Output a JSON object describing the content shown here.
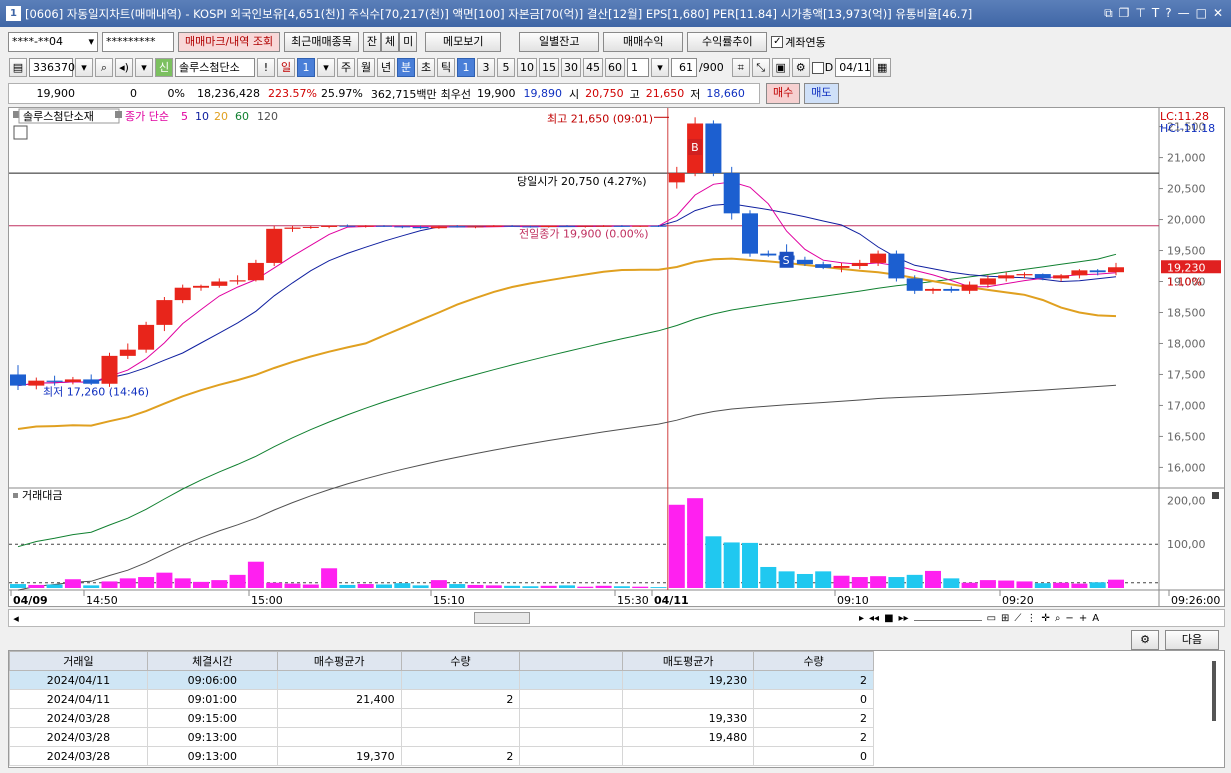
{
  "window": {
    "num": "1",
    "title": "[0606] 자동일지차트(매매내역) - KOSPI 외국인보유[4,651(천)] 주식수[70,217(천)] 액면[100] 자본금[70(억)] 결산[12월] EPS[1,680] PER[11.84] 시가총액[13,973(억)] 유통비율[46.7]"
  },
  "account": {
    "number": "****-**04",
    "password": "*********",
    "btn_mark": "매매마크/내역 조회",
    "btn_recent": "최근매매종목",
    "b_jan": "잔",
    "b_che": "체",
    "b_mi": "미",
    "btn_memo": "메모보기",
    "btn_daily": "일별잔고",
    "btn_profit": "매매수익",
    "btn_trend": "수익률추이",
    "chk_link": "계좌연동"
  },
  "toolbar": {
    "code": "336370",
    "credit": "신",
    "stock_name": "솔루스첨단소",
    "period": {
      "il": "일",
      "n": "1",
      "ju": "주",
      "wol": "월",
      "nyeon": "년",
      "bun": "분",
      "cho": "초",
      "tik": "틱"
    },
    "intervals": [
      "1",
      "3",
      "5",
      "10",
      "15",
      "30",
      "45",
      "60"
    ],
    "count_sel": "1",
    "count": "61",
    "count_max": "/900",
    "d_label": "D",
    "date": "04/11"
  },
  "quote": {
    "price": "19,900",
    "change": "0",
    "rate": "0%",
    "volume": "18,236,428",
    "v1": "223.57%",
    "v2": "25.97%",
    "amount": "362,715백만",
    "bid_label": "최우선",
    "bid1": "19,900",
    "bid2": "19,890",
    "open_label": "시",
    "open": "20,750",
    "high_label": "고",
    "high": "21,650",
    "low_label": "저",
    "low": "18,660",
    "buy": "매수",
    "sell": "매도"
  },
  "chart": {
    "stock": "솔루스첨단소재",
    "ma_label": "종가 단순",
    "ma_periods": [
      "5",
      "10",
      "20",
      "60",
      "120"
    ],
    "ma_colors": {
      "5": "#e000a0",
      "10": "#1020a0",
      "20": "#e0a020",
      "60": "#108030",
      "120": "#505050"
    },
    "lc": "LC:11.28",
    "hc": "HC:-11.18",
    "current": "19,230",
    "current_pct": "1.10%",
    "y_ticks": [
      "21,500",
      "21,000",
      "20,500",
      "20,000",
      "19,500",
      "19,000",
      "18,500",
      "18,000",
      "17,500",
      "17,000",
      "16,500",
      "16,000"
    ],
    "ann_high": "최고 21,650 (09:01)",
    "ann_open": "당일시가 20,750 (4.27%)",
    "ann_prev": "전일종가 19,900 (0.00%)",
    "ann_low": "최저 17,260 (14:46)",
    "mark_buy": "B",
    "mark_sell": "S",
    "vol_title": "거래대금",
    "vol_ticks": [
      "200,00",
      "100,00"
    ],
    "x_labels": [
      "04/09",
      "14:50",
      "15:00",
      "15:10",
      "15:30",
      "04/11",
      "09:10",
      "09:20",
      "09:26:00"
    ],
    "up": "#e8251b",
    "down": "#1c5fd0",
    "vol_up": "#ff20f0",
    "vol_down": "#20c8f0"
  },
  "chart_data": {
    "type": "candlestick",
    "candles": [
      [
        17500,
        17650,
        17250,
        17320
      ],
      [
        17320,
        17450,
        17260,
        17400
      ],
      [
        17400,
        17480,
        17320,
        17380
      ],
      [
        17380,
        17460,
        17340,
        17420
      ],
      [
        17420,
        17500,
        17330,
        17350
      ],
      [
        17350,
        17850,
        17300,
        17800
      ],
      [
        17800,
        18000,
        17750,
        17900
      ],
      [
        17900,
        18350,
        17850,
        18300
      ],
      [
        18300,
        18750,
        18200,
        18700
      ],
      [
        18700,
        18950,
        18650,
        18900
      ],
      [
        18900,
        18950,
        18850,
        18930
      ],
      [
        18930,
        19050,
        18900,
        19000
      ],
      [
        19000,
        19100,
        18950,
        19020
      ],
      [
        19020,
        19350,
        19000,
        19300
      ],
      [
        19300,
        19900,
        19250,
        19850
      ],
      [
        19850,
        19900,
        19800,
        19870
      ],
      [
        19870,
        19900,
        19850,
        19880
      ],
      [
        19880,
        19900,
        19860,
        19900
      ],
      [
        19900,
        19920,
        19880,
        19890
      ],
      [
        19890,
        19910,
        19870,
        19900
      ],
      [
        19900,
        19910,
        19880,
        19890
      ],
      [
        19890,
        19900,
        19860,
        19880
      ],
      [
        19880,
        19900,
        19850,
        19860
      ],
      [
        19860,
        19900,
        19850,
        19890
      ],
      [
        19890,
        19910,
        19870,
        19880
      ],
      [
        19880,
        19900,
        19860,
        19890
      ],
      [
        19890,
        19910,
        19880,
        19900
      ],
      [
        19900,
        19910,
        19880,
        19890
      ],
      [
        19890,
        19900,
        19870,
        19880
      ],
      [
        19880,
        19900,
        19870,
        19900
      ],
      [
        19900,
        19910,
        19880,
        19890
      ],
      [
        19890,
        19900,
        19870,
        19900
      ],
      [
        19900,
        19910,
        19880,
        19900
      ],
      [
        19900,
        19910,
        19880,
        19890
      ],
      [
        19890,
        19900,
        19880,
        19900
      ],
      [
        19900,
        19910,
        19880,
        19890
      ],
      [
        20600,
        20850,
        20500,
        20750
      ],
      [
        20750,
        21650,
        20700,
        21550
      ],
      [
        21550,
        21600,
        20700,
        20750
      ],
      [
        20750,
        20850,
        20000,
        20100
      ],
      [
        20100,
        20150,
        19400,
        19450
      ],
      [
        19450,
        19500,
        19400,
        19420
      ],
      [
        19420,
        19600,
        19300,
        19350
      ],
      [
        19350,
        19400,
        19250,
        19280
      ],
      [
        19280,
        19320,
        19200,
        19220
      ],
      [
        19220,
        19300,
        19150,
        19250
      ],
      [
        19250,
        19350,
        19200,
        19300
      ],
      [
        19300,
        19500,
        19250,
        19450
      ],
      [
        19450,
        19500,
        19000,
        19050
      ],
      [
        19050,
        19100,
        18800,
        18850
      ],
      [
        18850,
        18900,
        18800,
        18880
      ],
      [
        18880,
        18920,
        18820,
        18850
      ],
      [
        18850,
        19000,
        18800,
        18950
      ],
      [
        18950,
        19100,
        18900,
        19050
      ],
      [
        19050,
        19150,
        19000,
        19100
      ],
      [
        19100,
        19150,
        19050,
        19120
      ],
      [
        19120,
        19130,
        19020,
        19050
      ],
      [
        19050,
        19120,
        19000,
        19100
      ],
      [
        19100,
        19200,
        19050,
        19180
      ],
      [
        19180,
        19200,
        19100,
        19150
      ],
      [
        19150,
        19300,
        19100,
        19230
      ]
    ],
    "volumes": [
      9,
      7,
      8,
      20,
      6,
      15,
      22,
      25,
      35,
      22,
      14,
      18,
      30,
      60,
      12,
      10,
      8,
      45,
      7,
      9,
      8,
      11,
      6,
      18,
      9,
      7,
      6,
      5,
      4,
      5,
      6,
      3,
      5,
      4,
      3,
      2,
      190,
      205,
      118,
      104,
      103,
      48,
      38,
      32,
      38,
      28,
      25,
      27,
      25,
      30,
      39,
      22,
      12,
      18,
      17,
      15,
      11,
      12,
      10,
      13,
      19
    ],
    "ylim": [
      15700,
      21800
    ],
    "vol_max": 210
  },
  "table": {
    "headers": [
      "거래일",
      "체결시간",
      "매수평균가",
      "수량",
      "",
      "매도평균가",
      "수량"
    ],
    "rows": [
      [
        "2024/04/11",
        "09:06:00",
        "",
        "",
        "",
        "19,230",
        "2"
      ],
      [
        "2024/04/11",
        "09:01:00",
        "21,400",
        "2",
        "",
        "",
        "0"
      ],
      [
        "2024/03/28",
        "09:15:00",
        "",
        "",
        "",
        "19,330",
        "2"
      ],
      [
        "2024/03/28",
        "09:13:00",
        "",
        "",
        "",
        "19,480",
        "2"
      ],
      [
        "2024/03/28",
        "09:13:00",
        "19,370",
        "2",
        "",
        "",
        "0"
      ]
    ]
  },
  "bottom": {
    "next": "다음"
  }
}
